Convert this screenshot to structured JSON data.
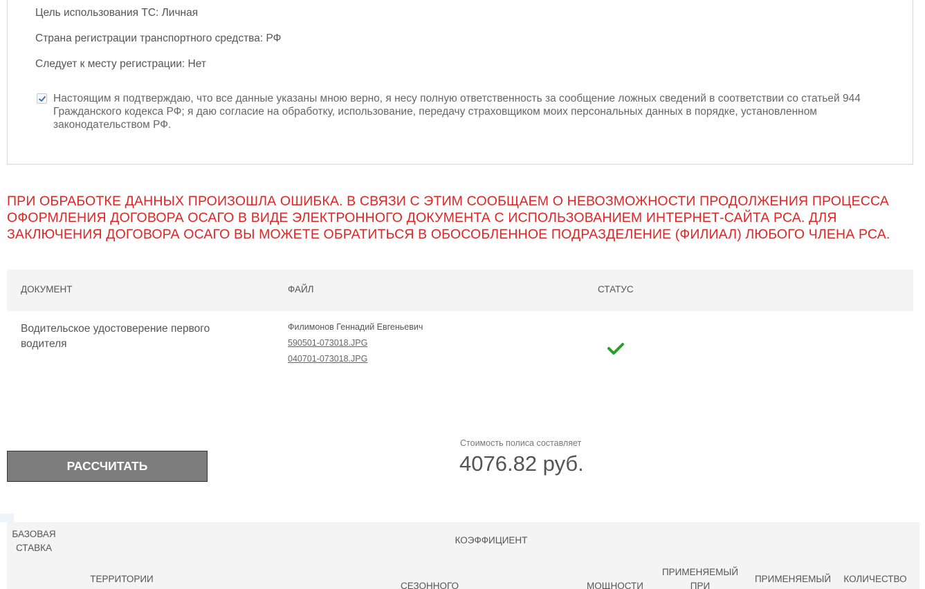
{
  "summary": {
    "usage_purpose": "Цель использования ТС: Личная",
    "registration_country": "Страна регистрации транспортного средства: РФ",
    "follows_to_registration": "Следует к месту регистрации: Нет",
    "consent_checked": true,
    "consent_text": "Настоящим я подтверждаю, что все данные указаны мною верно, я несу полную ответственность за сообщение ложных сведений в соответствии со статьей 944 Гражданского кодекса РФ; я даю согласие на обработку, использование, передачу страховщиком моих персональных данных в порядке, установленном законодательством РФ."
  },
  "error_message": "ПРИ ОБРАБОТКЕ ДАННЫХ ПРОИЗОШЛА ОШИБКА. В СВЯЗИ С ЭТИМ СООБЩАЕМ О НЕВОЗМОЖНОСТИ ПРОДОЛЖЕНИЯ ПРОЦЕССА ОФОРМЛЕНИЯ ДОГОВОРА ОСАГО В ВИДЕ ЭЛЕКТРОННОГО ДОКУМЕНТА С ИСПОЛЬЗОВАНИЕМ ИНТЕРНЕТ-САЙТА РСА. ДЛЯ ЗАКЛЮЧЕНИЯ ДОГОВОРА ОСАГО ВЫ МОЖЕТЕ ОБРАТИТЬСЯ В ОБОСОБЛЕННОЕ ПОДРАЗДЕЛЕНИЕ (ФИЛИАЛ) ЛЮБОГО ЧЛЕНА РСА.",
  "documents": {
    "headers": {
      "document": "ДОКУМЕНТ",
      "file": "ФАЙЛ",
      "status": "СТАТУС"
    },
    "rows": [
      {
        "document": "Водительское удостоверение первого водителя",
        "owner": "Филимонов Геннадий Евгеньевич",
        "files": [
          "590501-073018.JPG",
          "040701-073018.JPG"
        ],
        "status_icon": "check-icon"
      }
    ]
  },
  "calc_button_label": "РАССЧИТАТЬ",
  "price": {
    "label": "Стоимость полиса составляет",
    "value": "4076.82 руб."
  },
  "coef_table": {
    "base_rate": "БАЗОВАЯ СТАВКА",
    "coefficient": "КОЭФФИЦИЕНТ",
    "territory": "ТЕРРИТОРИИ",
    "seasonal": "СЕЗОННОГО",
    "power": "МОЩНОСТИ",
    "applied_1": "ПРИМЕНЯЕМЫЙ ПРИ",
    "applied_2": "ПРИМЕНЯЕМЫЙ",
    "count": "КОЛИЧЕСТВО"
  },
  "colors": {
    "error": "#e02525",
    "success": "#2a9d2a",
    "button": "#7d7d7d"
  }
}
